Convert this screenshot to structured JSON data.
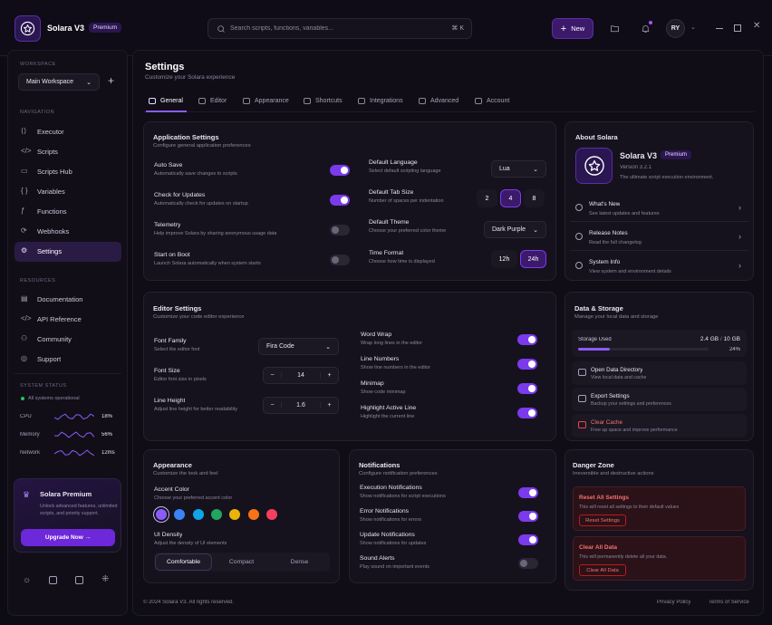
{
  "app": {
    "name": "Solara V3",
    "badge": "Premium"
  },
  "search": {
    "placeholder": "Search scripts, functions, variables...",
    "shortcut": "⌘ K"
  },
  "header": {
    "new_label": "New",
    "avatar": "RY"
  },
  "sidebar": {
    "workspace_heading": "WORKSPACE",
    "workspace_value": "Main Workspace",
    "nav_heading": "NAVIGATION",
    "nav": [
      {
        "label": "Executor",
        "icon": "code-bracket-icon"
      },
      {
        "label": "Scripts",
        "icon": "code-icon"
      },
      {
        "label": "Scripts Hub",
        "icon": "folder-icon"
      },
      {
        "label": "Variables",
        "icon": "braces-icon"
      },
      {
        "label": "Functions",
        "icon": "function-icon"
      },
      {
        "label": "Webhooks",
        "icon": "webhook-icon"
      },
      {
        "label": "Settings",
        "icon": "gear-icon"
      }
    ],
    "resources_heading": "RESOURCES",
    "resources": [
      {
        "label": "Documentation",
        "icon": "document-icon"
      },
      {
        "label": "API Reference",
        "icon": "code-icon"
      },
      {
        "label": "Community",
        "icon": "users-icon"
      },
      {
        "label": "Support",
        "icon": "support-icon"
      }
    ],
    "status_heading": "SYSTEM STATUS",
    "status_text": "All systems operational",
    "metrics": [
      {
        "label": "CPU",
        "value": "18%"
      },
      {
        "label": "Memory",
        "value": "56%"
      },
      {
        "label": "Network",
        "value": "12ms"
      }
    ],
    "premium": {
      "title": "Solara Premium",
      "desc": "Unlock advanced features, unlimited scripts, and priority support.",
      "button": "Upgrade Now →"
    }
  },
  "page": {
    "title": "Settings",
    "subtitle": "Customize your Solara experience"
  },
  "tabs": [
    "General",
    "Editor",
    "Appearance",
    "Shortcuts",
    "Integrations",
    "Advanced",
    "Account"
  ],
  "app_settings": {
    "title": "Application Settings",
    "subtitle": "Configure general application preferences",
    "toggles": [
      {
        "label": "Auto Save",
        "desc": "Automatically save changes to scripts",
        "on": true
      },
      {
        "label": "Check for Updates",
        "desc": "Automatically check for updates on startup",
        "on": true
      },
      {
        "label": "Telemetry",
        "desc": "Help improve Solara by sharing anonymous usage data",
        "on": false
      },
      {
        "label": "Start on Boot",
        "desc": "Launch Solara automatically when system starts",
        "on": false
      }
    ],
    "language": {
      "label": "Default Language",
      "desc": "Select default scripting language",
      "value": "Lua"
    },
    "tabsize": {
      "label": "Default Tab Size",
      "desc": "Number of spaces per indentation",
      "options": [
        "2",
        "4",
        "8"
      ],
      "selected": "4"
    },
    "theme": {
      "label": "Default Theme",
      "desc": "Choose your preferred color theme",
      "value": "Dark Purple"
    },
    "timeformat": {
      "label": "Time Format",
      "desc": "Choose how time is displayed",
      "options": [
        "12h",
        "24h"
      ],
      "selected": "24h"
    }
  },
  "about": {
    "title": "About Solara",
    "name": "Solara V3",
    "badge": "Premium",
    "version": "Version 3.2.1",
    "tagline": "The ultimate script execution environment.",
    "links": [
      {
        "label": "What's New",
        "desc": "See latest updates and features"
      },
      {
        "label": "Release Notes",
        "desc": "Read the full changelog"
      },
      {
        "label": "System Info",
        "desc": "View system and environment details"
      }
    ]
  },
  "editor": {
    "title": "Editor Settings",
    "subtitle": "Customize your code editor experience",
    "font_family": {
      "label": "Font Family",
      "desc": "Select the editor font",
      "value": "Fira Code"
    },
    "font_size": {
      "label": "Font Size",
      "desc": "Editor font size in pixels",
      "value": "14"
    },
    "line_height": {
      "label": "Line Height",
      "desc": "Adjust line height for better readability",
      "value": "1.6"
    },
    "toggles": [
      {
        "label": "Word Wrap",
        "desc": "Wrap long lines in the editor",
        "on": true
      },
      {
        "label": "Line Numbers",
        "desc": "Show line numbers in the editor",
        "on": true
      },
      {
        "label": "Minimap",
        "desc": "Show code minimap",
        "on": true
      },
      {
        "label": "Highlight Active Line",
        "desc": "Highlight the current line",
        "on": true
      }
    ]
  },
  "storage": {
    "title": "Data & Storage",
    "subtitle": "Manage your local data and storage",
    "used_label": "Storage Used",
    "used": "2.4 GB",
    "sep": "/",
    "total": "10 GB",
    "percent": "24%",
    "fraction": 0.24,
    "items": [
      {
        "label": "Open Data Directory",
        "desc": "View local data and cache"
      },
      {
        "label": "Export Settings",
        "desc": "Backup your settings and preferences"
      },
      {
        "label": "Clear Cache",
        "desc": "Free up space and improve performance"
      }
    ]
  },
  "appearance": {
    "title": "Appearance",
    "subtitle": "Customize the look and feel",
    "accent_label": "Accent Color",
    "accent_desc": "Choose your preferred accent color",
    "colors": [
      "#8b5cf6",
      "#3b82f6",
      "#0ea5e9",
      "#22a55e",
      "#eab308",
      "#f97316",
      "#f43f5e"
    ],
    "density_label": "UI Density",
    "density_desc": "Adjust the density of UI elements",
    "density_options": [
      "Comfortable",
      "Compact",
      "Dense"
    ],
    "density_selected": "Comfortable"
  },
  "notifications": {
    "title": "Notifications",
    "subtitle": "Configure notification preferences",
    "toggles": [
      {
        "label": "Execution Notifications",
        "desc": "Show notifications for script executions",
        "on": true
      },
      {
        "label": "Error Notifications",
        "desc": "Show notifications for errors",
        "on": true
      },
      {
        "label": "Update Notifications",
        "desc": "Show notifications for updates",
        "on": true
      },
      {
        "label": "Sound Alerts",
        "desc": "Play sound on important events",
        "on": false
      }
    ]
  },
  "danger": {
    "title": "Danger Zone",
    "subtitle": "Irreversible and destructive actions",
    "reset": {
      "title": "Reset All Settings",
      "desc": "This will reset all settings to their default values",
      "button": "Reset Settings"
    },
    "clear": {
      "title": "Clear All Data",
      "desc": "This will permanently delete all your data.",
      "button": "Clear All Data"
    }
  },
  "footer": {
    "copyright": "© 2024 Solara V3. All rights reserved.",
    "privacy": "Privacy Policy",
    "terms": "Terms of Service"
  },
  "colors": {
    "accent": "#7c3aed",
    "danger": "#ef4444",
    "bg": "#0d0b14"
  }
}
